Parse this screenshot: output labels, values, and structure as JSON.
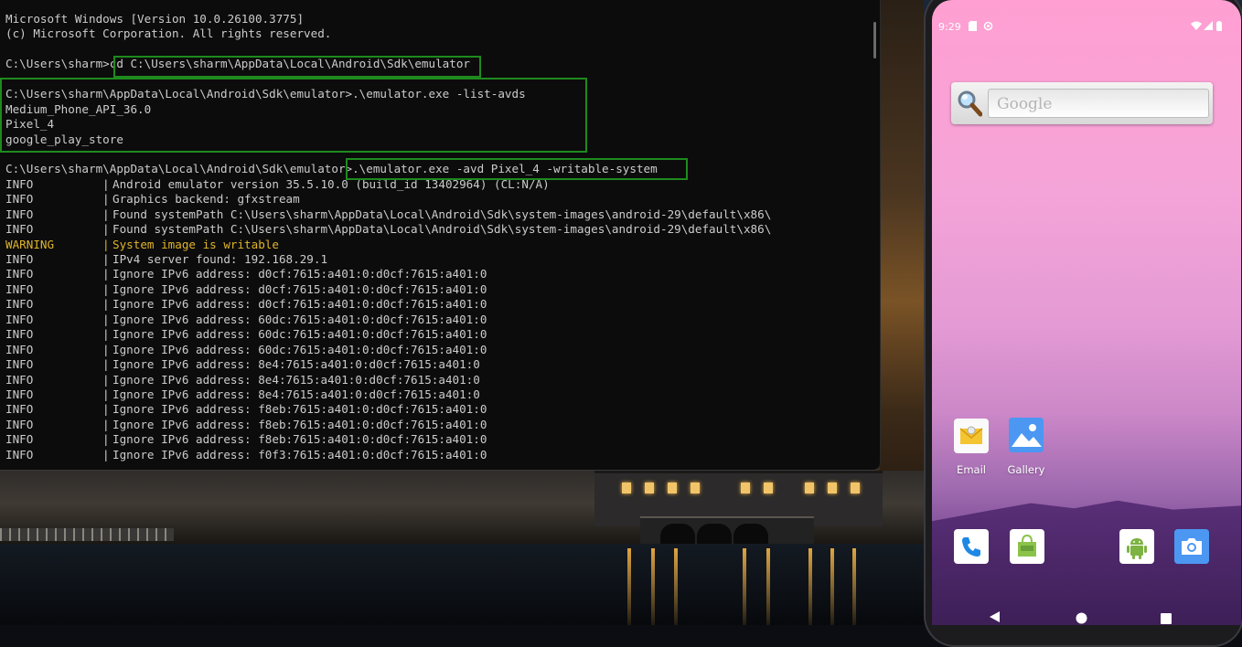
{
  "terminal": {
    "lines": [
      "Microsoft Windows [Version 10.0.26100.3775]",
      "(c) Microsoft Corporation. All rights reserved.",
      "",
      "C:\\Users\\sharm>cd C:\\Users\\sharm\\AppData\\Local\\Android\\Sdk\\emulator",
      "",
      "C:\\Users\\sharm\\AppData\\Local\\Android\\Sdk\\emulator>.\\emulator.exe -list-avds",
      "Medium_Phone_API_36.0",
      "Pixel_4",
      "google_play_store",
      "",
      "C:\\Users\\sharm\\AppData\\Local\\Android\\Sdk\\emulator>.\\emulator.exe -avd Pixel_4 -writable-system"
    ],
    "log_separator": "|",
    "log": [
      {
        "level": "INFO",
        "msg": "Android emulator version 35.5.10.0 (build_id 13402964) (CL:N/A)"
      },
      {
        "level": "INFO",
        "msg": "Graphics backend: gfxstream"
      },
      {
        "level": "INFO",
        "msg": "Found systemPath C:\\Users\\sharm\\AppData\\Local\\Android\\Sdk\\system-images\\android-29\\default\\x86\\"
      },
      {
        "level": "INFO",
        "msg": "Found systemPath C:\\Users\\sharm\\AppData\\Local\\Android\\Sdk\\system-images\\android-29\\default\\x86\\"
      },
      {
        "level": "WARNING",
        "msg": "System image is writable"
      },
      {
        "level": "INFO",
        "msg": "IPv4 server found: 192.168.29.1"
      },
      {
        "level": "INFO",
        "msg": "Ignore IPv6 address: d0cf:7615:a401:0:d0cf:7615:a401:0"
      },
      {
        "level": "INFO",
        "msg": "Ignore IPv6 address: d0cf:7615:a401:0:d0cf:7615:a401:0"
      },
      {
        "level": "INFO",
        "msg": "Ignore IPv6 address: d0cf:7615:a401:0:d0cf:7615:a401:0"
      },
      {
        "level": "INFO",
        "msg": "Ignore IPv6 address: 60dc:7615:a401:0:d0cf:7615:a401:0"
      },
      {
        "level": "INFO",
        "msg": "Ignore IPv6 address: 60dc:7615:a401:0:d0cf:7615:a401:0"
      },
      {
        "level": "INFO",
        "msg": "Ignore IPv6 address: 60dc:7615:a401:0:d0cf:7615:a401:0"
      },
      {
        "level": "INFO",
        "msg": "Ignore IPv6 address: 8e4:7615:a401:0:d0cf:7615:a401:0"
      },
      {
        "level": "INFO",
        "msg": "Ignore IPv6 address: 8e4:7615:a401:0:d0cf:7615:a401:0"
      },
      {
        "level": "INFO",
        "msg": "Ignore IPv6 address: 8e4:7615:a401:0:d0cf:7615:a401:0"
      },
      {
        "level": "INFO",
        "msg": "Ignore IPv6 address: f8eb:7615:a401:0:d0cf:7615:a401:0"
      },
      {
        "level": "INFO",
        "msg": "Ignore IPv6 address: f8eb:7615:a401:0:d0cf:7615:a401:0"
      },
      {
        "level": "INFO",
        "msg": "Ignore IPv6 address: f8eb:7615:a401:0:d0cf:7615:a401:0"
      },
      {
        "level": "INFO",
        "msg": "Ignore IPv6 address: f0f3:7615:a401:0:d0cf:7615:a401:0"
      }
    ],
    "colors": {
      "background": "#0c0c0c",
      "text": "#cccccc",
      "warning": "#e0b42b",
      "highlight_box": "#1e8a1e"
    }
  },
  "phone": {
    "status_bar": {
      "time": "9:29"
    },
    "search_widget": {
      "logo_text": "Google"
    },
    "apps": {
      "email": {
        "label": "Email",
        "icon": "email-icon"
      },
      "gallery": {
        "label": "Gallery",
        "icon": "gallery-icon"
      }
    },
    "dock": [
      {
        "name": "phone",
        "icon": "phone-icon"
      },
      {
        "name": "store",
        "icon": "store-icon"
      },
      {
        "name": "android",
        "icon": "android-icon"
      },
      {
        "name": "camera",
        "icon": "camera-icon"
      }
    ],
    "nav": [
      {
        "name": "back",
        "icon": "back-triangle-icon"
      },
      {
        "name": "home",
        "icon": "home-circle-icon"
      },
      {
        "name": "recents",
        "icon": "recents-square-icon"
      }
    ]
  }
}
